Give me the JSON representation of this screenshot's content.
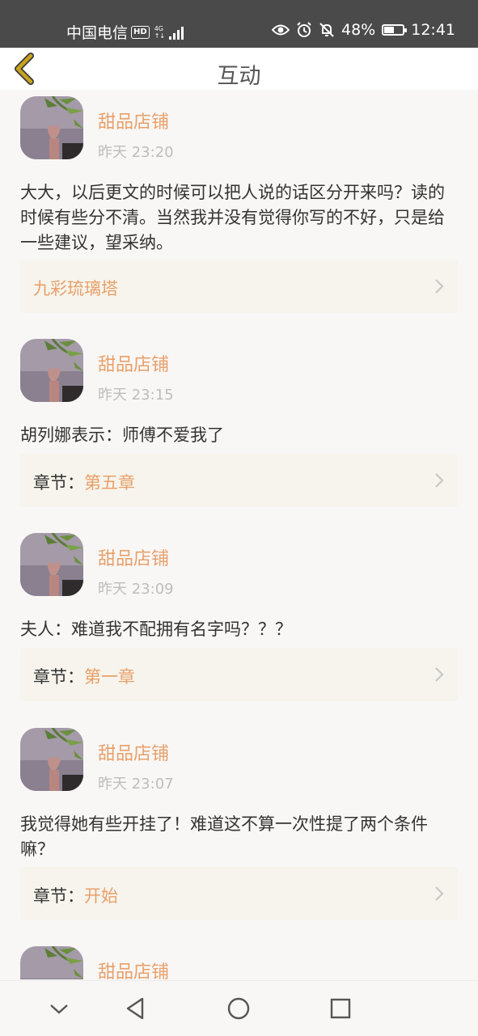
{
  "status_bar": {
    "carrier": "中国电信",
    "hd_badge": "HD",
    "network": "4G",
    "network_sub": "↑↓",
    "battery_percent": "48%",
    "battery_level": 0.48,
    "time": "12:41"
  },
  "header": {
    "title": "互动"
  },
  "comments": [
    {
      "user": "甜品店铺",
      "time": "昨天 23:20",
      "text": "大大，以后更文的时候可以把人说的话区分开来吗？读的时候有些分不清。当然我并没有觉得你写的不好，只是给一些建议，望采纳。",
      "chapter_prefix": "",
      "chapter": "九彩琉璃塔"
    },
    {
      "user": "甜品店铺",
      "time": "昨天 23:15",
      "text": "胡列娜表示：师傅不爱我了",
      "chapter_prefix": "章节：",
      "chapter": "第五章"
    },
    {
      "user": "甜品店铺",
      "time": "昨天 23:09",
      "text": "夫人：难道我不配拥有名字吗？？？",
      "chapter_prefix": "章节：",
      "chapter": "第一章"
    },
    {
      "user": "甜品店铺",
      "time": "昨天 23:07",
      "text": "我觉得她有些开挂了！难道这不算一次性提了两个条件嘛？",
      "chapter_prefix": "章节：",
      "chapter": "开始"
    },
    {
      "user": "甜品店铺"
    }
  ],
  "icons": {
    "back": "chevron-left-icon",
    "chapter_arrow": "chevron-right-icon",
    "nav": [
      "chevron-down-icon",
      "back-triangle-icon",
      "home-circle-icon",
      "recents-square-icon"
    ]
  },
  "colors": {
    "accent": "#e8a06a",
    "status_bar": "#4a4a4a",
    "chapter_bg": "#f6f4ec",
    "back_icon": "#c9a21c"
  }
}
